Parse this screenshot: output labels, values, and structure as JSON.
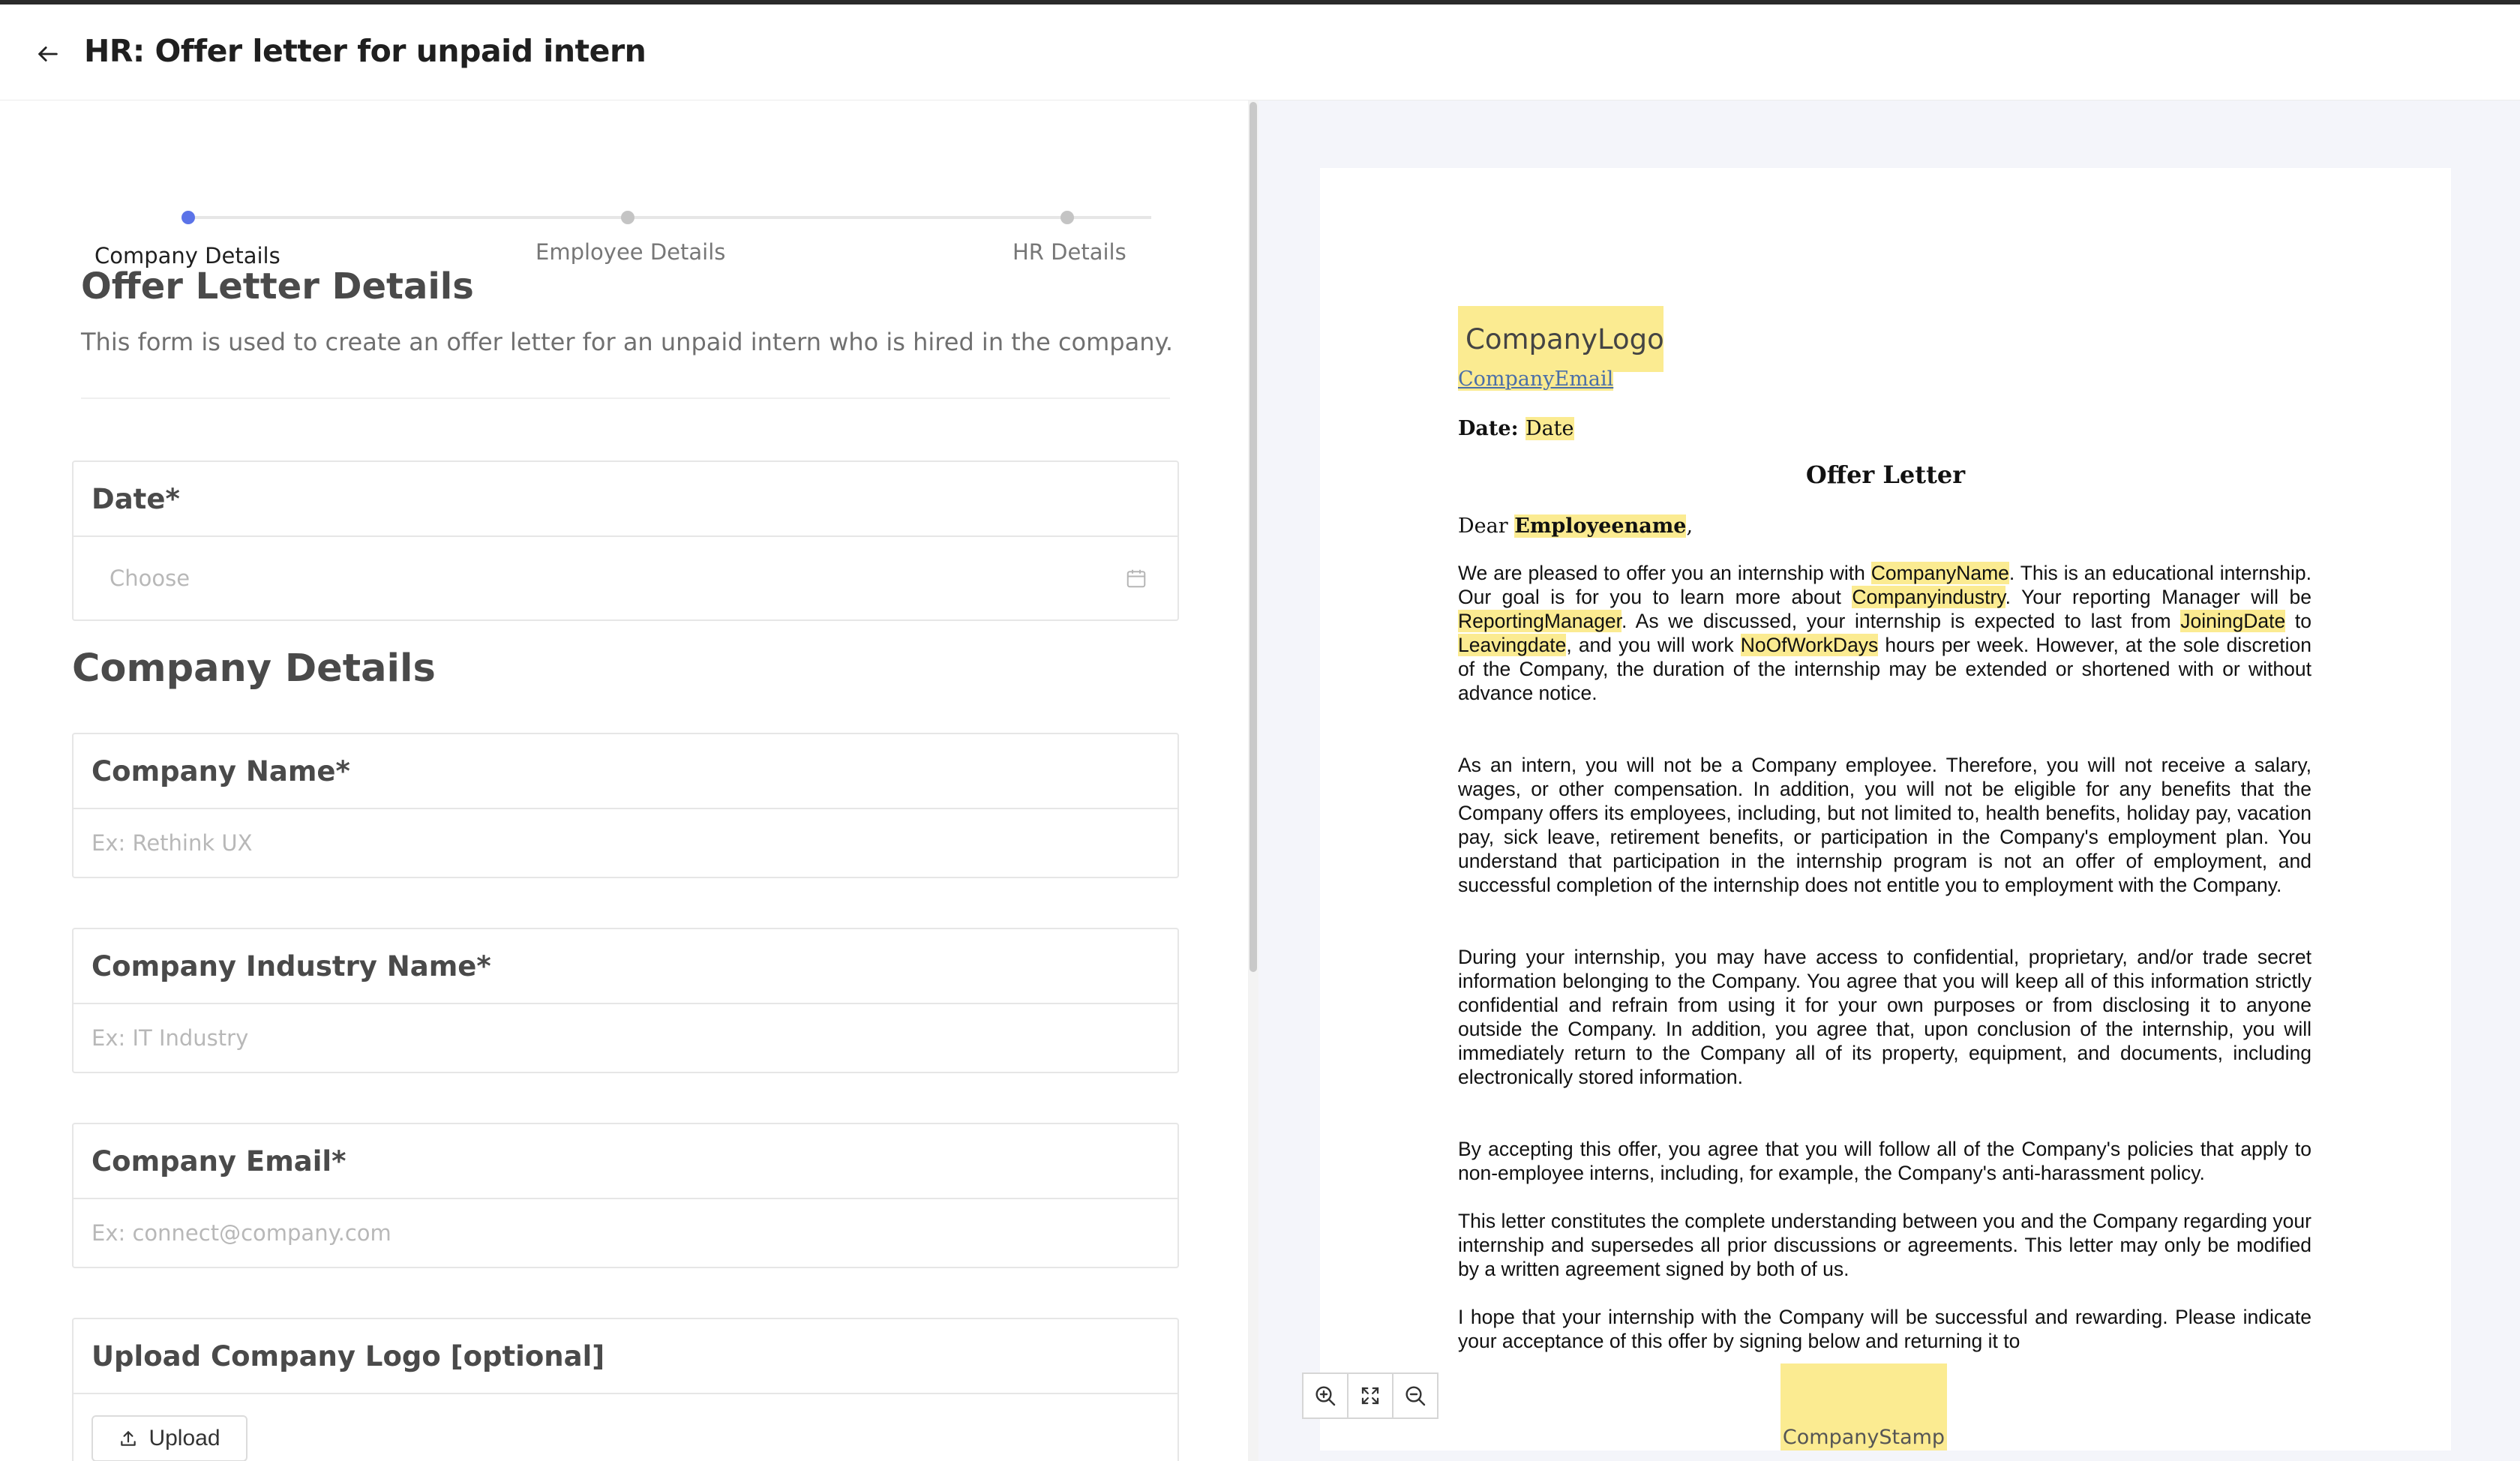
{
  "header": {
    "title": "HR: Offer letter for unpaid intern"
  },
  "stepper": {
    "steps": [
      {
        "label": "Company Details",
        "active": true
      },
      {
        "label": "Employee Details",
        "active": false
      },
      {
        "label": "HR Details",
        "active": false
      }
    ]
  },
  "form": {
    "section_title": "Offer Letter Details",
    "section_desc": "This form is used to create an offer letter for an unpaid intern who is hired in the company.",
    "date": {
      "label": "Date*",
      "placeholder": "Choose"
    },
    "company_section_title": "Company Details",
    "company_name": {
      "label": "Company Name*",
      "placeholder": "Ex: Rethink UX"
    },
    "company_industry": {
      "label": "Company Industry Name*",
      "placeholder": "Ex: IT Industry"
    },
    "company_email": {
      "label": "Company Email*",
      "placeholder": "Ex: connect@company.com"
    },
    "company_logo": {
      "label": "Upload Company Logo [optional]",
      "button": "Upload"
    }
  },
  "preview": {
    "logo": "CompanyLogo",
    "email": "CompanyEmail",
    "date_label": "Date",
    "date_value": "Date",
    "title": "Offer Letter",
    "dear": "Dear",
    "employee_name": "Employeename",
    "p1": {
      "a": "We are pleased to offer you an internship with ",
      "company_name": "CompanyName",
      "b": ". This is an educational internship. Our goal is for you to learn more about ",
      "company_industry": "Companyindustry",
      "c": ". Your reporting Manager will be ",
      "reporting_manager": "ReportingManager",
      "d": ". As we discussed, your internship is expected to last from ",
      "joining_date": "JoiningDate",
      "e": " to ",
      "leaving_date": "Leavingdate",
      "f": ", and you will work ",
      "work_days": "NoOfWorkDays",
      "g": " hours per week. However, at the sole discretion of the Company, the duration of the internship may be extended or shortened with or without advance notice."
    },
    "p2": "As an intern, you will not be a Company employee. Therefore, you will not receive a salary, wages, or other compensation. In addition, you will not be eligible for any benefits that the Company offers its employees, including, but not limited to, health benefits, holiday pay, vacation pay, sick leave, retirement benefits, or participation in the Company's employment plan. You understand that participation in the internship program is not an offer of employment, and successful completion of the internship does not entitle you to employment with the Company.",
    "p3": "During your internship, you may have access to confidential, proprietary, and/or trade secret information belonging to the Company. You agree that you will keep all of this information strictly confidential and refrain from using it for your own purposes or from disclosing it to anyone outside the Company. In addition, you agree that, upon conclusion of the internship, you will immediately return to the Company all of its property, equipment, and documents, including electronically stored information.",
    "p4": "By accepting this offer, you agree that you will follow all of the Company's policies that apply to non-employee interns, including, for example, the Company's anti-harassment policy.",
    "p5": "This letter constitutes the complete understanding between you and the Company regarding your internship and supersedes all prior discussions or agreements. This letter may only be modified by a written agreement signed by both of us.",
    "p6": "I hope that your internship with the Company will be successful and rewarding. Please indicate your acceptance of this offer by signing below and returning it to",
    "stamp": "CompanyStamp"
  },
  "colors": {
    "accent": "#5b73e8",
    "highlight": "#fbeb91",
    "inactive_dot": "#c4c4c4"
  },
  "icons": {
    "back": "arrow-left-icon",
    "calendar": "calendar-icon",
    "upload": "upload-icon",
    "zoom_in": "zoom-in-icon",
    "fit": "fit-screen-icon",
    "zoom_out": "zoom-out-icon"
  }
}
